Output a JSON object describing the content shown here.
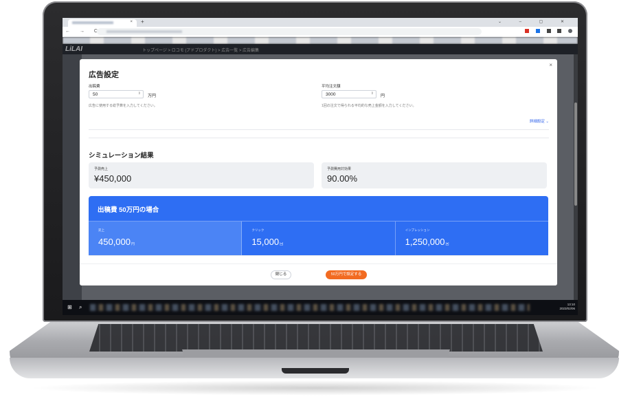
{
  "browser": {
    "new_tab": "+",
    "tab_close": "×",
    "window_controls": "⌄ – ▢ ✕",
    "nav_icons": "← → C ⌂"
  },
  "app": {
    "logo": "LiLAI",
    "breadcrumb": "トップページ > ロコモ (アドプロダクト) > 広告一覧 > 広告編集"
  },
  "taskbar": {
    "start_icon": "⊞",
    "search_icon": "⌕",
    "time": "13:10",
    "date": "2023/02/06"
  },
  "modal": {
    "title": "広告設定",
    "close": "×",
    "budget": {
      "label": "出稿費",
      "value": "50",
      "unit": "万円",
      "hint": "広告に使用する総予算を入力してください。"
    },
    "avg_order": {
      "label": "平均注文額",
      "value": "3000",
      "unit": "円",
      "hint": "1回の注文で得られる平均的な売上金額を入力してください。"
    },
    "advanced": "詳細設定 ⌄",
    "results_title": "シミュレーション結果",
    "cards": [
      {
        "label": "予測売上",
        "value": "¥450,000"
      },
      {
        "label": "予測費用対効果",
        "value": "90.00%"
      }
    ],
    "scenario": {
      "title": "出稿費 50万円の場合",
      "metrics": [
        {
          "label": "売上",
          "value": "450,000",
          "suffix": "円"
        },
        {
          "label": "クリック",
          "value": "15,000",
          "suffix": "回"
        },
        {
          "label": "インプレッション",
          "value": "1,250,000",
          "suffix": "回"
        }
      ]
    },
    "buttons": {
      "close": "閉じる",
      "apply": "50万円で設定する"
    }
  },
  "colors": {
    "accent_blue": "#2e6ef3",
    "accent_orange": "#f26b21"
  }
}
